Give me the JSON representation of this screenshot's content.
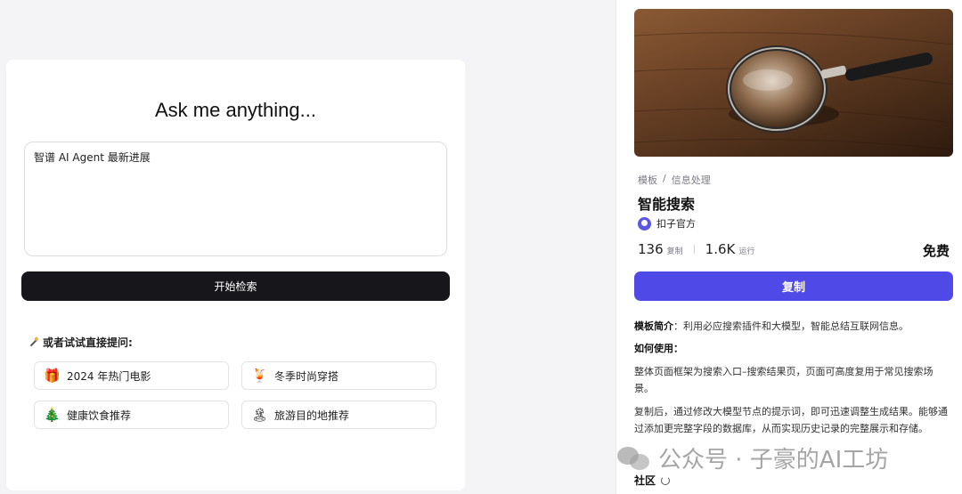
{
  "main": {
    "title": "Ask me anything...",
    "query_value": "智谱 AI Agent 最新进展",
    "search_button": "开始检索",
    "try_label": "或者试试直接提问:",
    "suggestions": [
      {
        "icon": "gift-icon",
        "glyph": "🎁",
        "label": "2024 年热门电影"
      },
      {
        "icon": "cocktail-icon",
        "glyph": "🍹",
        "label": "冬季时尚穿搭"
      },
      {
        "icon": "tree-icon",
        "glyph": "🎄",
        "label": "健康饮食推荐"
      },
      {
        "icon": "island-icon",
        "glyph": "🏝",
        "label": "旅游目的地推荐"
      }
    ]
  },
  "panel": {
    "breadcrumb": [
      "模板",
      "/",
      "信息处理"
    ],
    "title": "智能搜索",
    "author": "扣子官方",
    "stats": {
      "copies": "136",
      "copies_unit": "复制",
      "runs": "1.6K",
      "runs_unit": "运行"
    },
    "price": "免费",
    "copy_button": "复制",
    "intro_label": "模板简介",
    "intro_text": "：利用必应搜索插件和大模型，智能总结互联网信息。",
    "usage_label": "如何使用：",
    "usage_1": "整体页面框架为搜索入口–搜索结果页，页面可高度复用于常见搜索场景。",
    "usage_2": "复制后，通过修改大模型节点的提示词，即可迅速调整生成结果。能够通过添加更完整字段的数据库，从而实现历史记录的完整展示和存储。",
    "community": "社区"
  },
  "watermark": "公众号 · 子豪的AI工坊",
  "colors": {
    "accent": "#4f49e8",
    "dark_button": "#17171b"
  }
}
